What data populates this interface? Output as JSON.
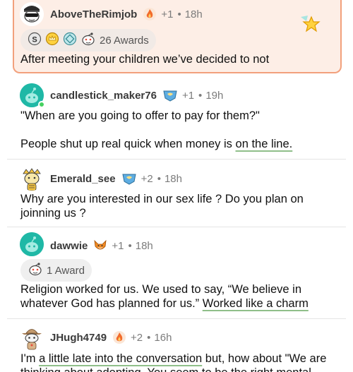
{
  "comments": [
    {
      "username": "AboveTheRimjob",
      "score": "+1",
      "time": "18h",
      "awards_label": "26 Awards",
      "text": "After meeting your children we’ve decided to not"
    },
    {
      "username": "candlestick_maker76",
      "score": "+1",
      "time": "19h",
      "text_1": "\"When are you going to offer to pay for them?\"",
      "text_2a": "People shut up real quick when money is ",
      "text_2b": "on the line."
    },
    {
      "username": "Emerald_see",
      "score": "+2",
      "time": "18h",
      "text": "Why are you interested in our sex life ? Do you plan on joinning us ?"
    },
    {
      "username": "dawwie",
      "score": "+1",
      "time": "18h",
      "awards_label": "1 Award",
      "text_a": "Religion worked for us.  We used to say, “We believe in whatever God has planned for us.”  ",
      "text_b": "Worked like a charm"
    },
    {
      "username": "JHugh4749",
      "score": "+2",
      "time": "16h",
      "text_a": "I'm ",
      "text_b": "a little late into the conversation",
      "text_c": " but, how about \"We are thinking about adopting. You seem to be the right mental"
    }
  ],
  "separator": "•",
  "colors": {
    "highlight_bg": "#fdeee6",
    "highlight_border": "#f2a07c",
    "underline": "#8fbf8a",
    "avatar_teal": "#1fb8a6"
  }
}
